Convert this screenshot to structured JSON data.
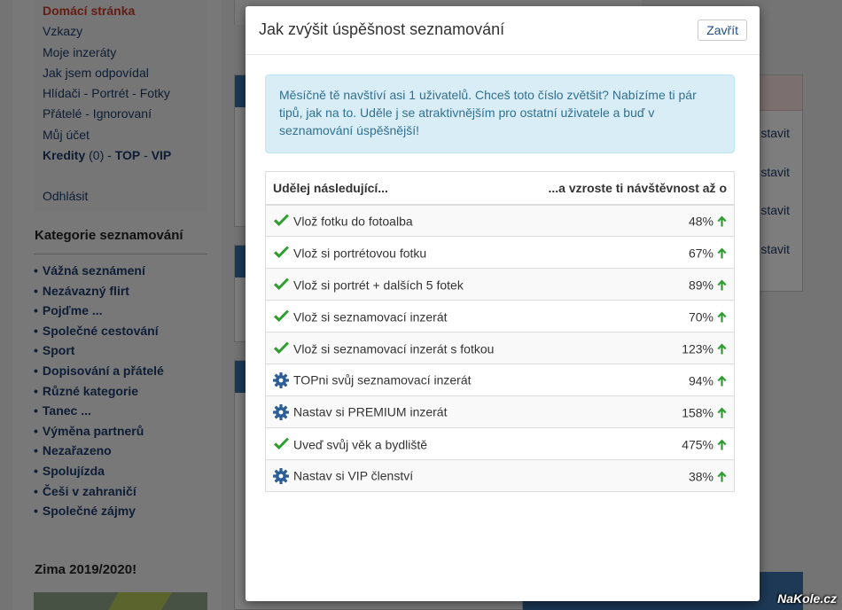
{
  "background": {
    "menu": [
      {
        "label": "Domácí stránka",
        "style": "active"
      },
      {
        "label": "Vzkazy",
        "style": ""
      },
      {
        "label": "Moje inzeráty",
        "style": ""
      },
      {
        "label": "Jak jsem odpovídal",
        "style": ""
      },
      {
        "label": "Hlídači - Portrét - Fotky",
        "style": ""
      },
      {
        "label": "Přátelé - Ignorovaní",
        "style": ""
      },
      {
        "label": "Můj účet",
        "style": ""
      },
      {
        "label": "Kredity",
        "style": "bold"
      },
      {
        "label": "Odhlásit",
        "style": ""
      }
    ],
    "credits_count": "(0)",
    "credits_top": "TOP",
    "credits_vip": "VIP",
    "categories_heading": "Kategorie seznamování",
    "categories": [
      "Vážná seznámení",
      "Nezávazný flirt",
      "Pojďme ...",
      "Společné cestování",
      "Sport",
      "Dopisování a přátelé",
      "Různé kategorie",
      "Tanec ...",
      "Výměna partnerů",
      "Nezařazeno",
      "Spolujízda",
      "Češi v zahraničí",
      "Společné zájmy"
    ],
    "season_heading": "Zima 2019/2020!",
    "right_links": [
      "stavit",
      "stavit",
      "stavit",
      "stavit"
    ]
  },
  "modal": {
    "title": "Jak zvýšit úspěšnost seznamování",
    "close_label": "Zavřít",
    "alert": "Měsíčně tě navštíví asi 1 uživatelů. Chceš toto číslo zvětšit? Nabízíme ti pár tipů, jak na to. Uděle j se atraktivnějším pro ostatní uživatele a buď v seznamování úspěšnější!",
    "table": {
      "col_action": "Udělej následující...",
      "col_gain": "...a vzroste ti návštěvnost až o",
      "rows": [
        {
          "icon": "check",
          "label": "Vlož fotku do fotoalba",
          "pct": "48%"
        },
        {
          "icon": "check",
          "label": "Vlož si portrétovou fotku",
          "pct": "67%"
        },
        {
          "icon": "check",
          "label": "Vlož si portrét + dalších 5 fotek",
          "pct": "89%"
        },
        {
          "icon": "check",
          "label": "Vlož si seznamovací inzerát",
          "pct": "70%"
        },
        {
          "icon": "check",
          "label": "Vlož si seznamovací inzerát s fotkou",
          "pct": "123%"
        },
        {
          "icon": "gear",
          "label": "TOPni svůj seznamovací inzerát",
          "pct": "94%"
        },
        {
          "icon": "gear",
          "label": "Nastav si PREMIUM inzerát",
          "pct": "158%"
        },
        {
          "icon": "check",
          "label": "Uveď svůj věk a bydliště",
          "pct": "475%"
        },
        {
          "icon": "gear",
          "label": "Nastav si VIP členství",
          "pct": "38%"
        }
      ]
    }
  },
  "colors": {
    "check": "#2e9e2e",
    "gear": "#2c5d94",
    "arrow": "#2e9e2e",
    "alert_bg": "#d9edf7",
    "alert_text": "#31708f"
  },
  "watermark": "NaKole.cz"
}
